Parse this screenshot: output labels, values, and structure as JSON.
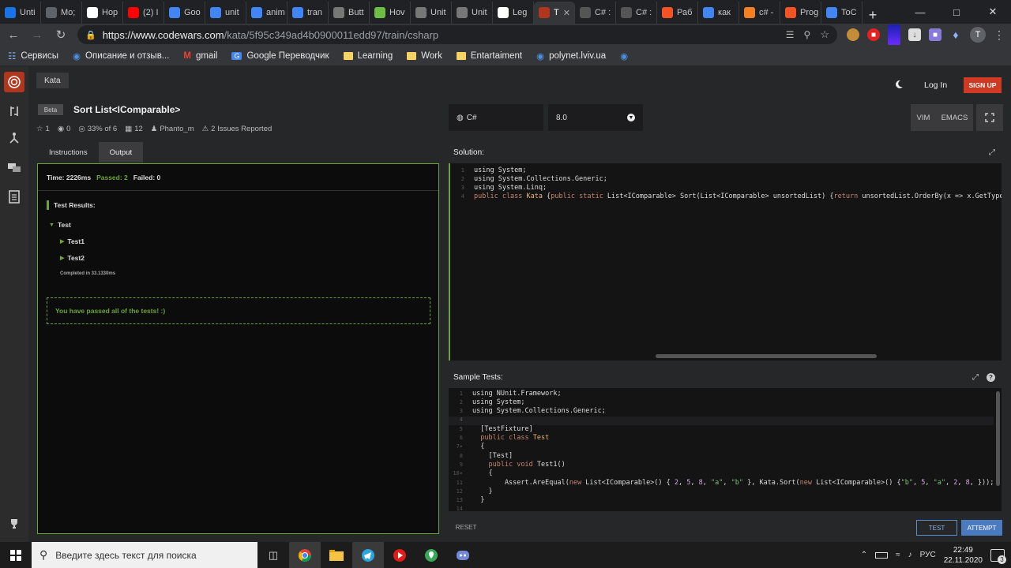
{
  "browser": {
    "tabs": [
      {
        "label": "Unti",
        "color": "#1a73e8"
      },
      {
        "label": "Mo;",
        "color": "#5f6368"
      },
      {
        "label": "Hop",
        "color": "#ffffff"
      },
      {
        "label": "(2) I",
        "color": "#ff0000"
      },
      {
        "label": "Goo",
        "color": "#4285f4"
      },
      {
        "label": "unit",
        "color": "#4285f4"
      },
      {
        "label": "anim",
        "color": "#4285f4"
      },
      {
        "label": "tran",
        "color": "#4285f4"
      },
      {
        "label": "Butt",
        "color": "#777777"
      },
      {
        "label": "Hov",
        "color": "#6cbe45"
      },
      {
        "label": "Unit",
        "color": "#777777"
      },
      {
        "label": "Unit",
        "color": "#777777"
      },
      {
        "label": "Leg",
        "color": "#ffffff"
      },
      {
        "label": "Т",
        "color": "#b1361e"
      },
      {
        "label": "C# :",
        "color": "#555555"
      },
      {
        "label": "C# :",
        "color": "#555555"
      },
      {
        "label": "Раб",
        "color": "#f35325"
      },
      {
        "label": "как",
        "color": "#4285f4"
      },
      {
        "label": "c# -",
        "color": "#f48024"
      },
      {
        "label": "Prog",
        "color": "#f35325"
      },
      {
        "label": "ToC",
        "color": "#4285f4"
      }
    ],
    "url_host": "https://www.codewars.com",
    "url_path": "/kata/5f95c349ad4b0900011edd97/train/csharp",
    "bookmarks": [
      {
        "label": "Сервисы",
        "type": "apps"
      },
      {
        "label": "Описание и отзыв...",
        "type": "site"
      },
      {
        "label": "gmail",
        "type": "gmail"
      },
      {
        "label": "Google Переводчик",
        "type": "translate"
      },
      {
        "label": "Learning",
        "type": "folder"
      },
      {
        "label": "Work",
        "type": "folder"
      },
      {
        "label": "Entartaiment",
        "type": "folder"
      },
      {
        "label": "polynet.lviv.ua",
        "type": "site"
      }
    ]
  },
  "codewars": {
    "kata_tab": "Kata",
    "login": "Log In",
    "signup": "SIGN UP",
    "beta": "Beta",
    "title": "Sort List<IComparable>",
    "stats": {
      "stars": "1",
      "favorites": "0",
      "satisfaction": "33% of 6",
      "completed": "12",
      "author": "Phanto_m",
      "issues": "2 Issues Reported"
    },
    "language": "C#",
    "version": "8.0",
    "mode_vim": "VIM",
    "mode_emacs": "EMACS",
    "tabs": {
      "instructions": "Instructions",
      "output": "Output"
    },
    "output": {
      "time": "Time: 2226ms",
      "passed": "Passed: 2",
      "failed": "Failed: 0",
      "results_title": "Test Results:",
      "group": "Test",
      "tests": [
        "Test1",
        "Test2"
      ],
      "completed": "Completed in 33.1330ms",
      "message": "You have passed all of the tests! :)"
    },
    "solution_title": "Solution:",
    "sample_title": "Sample Tests:",
    "reset": "RESET",
    "test": "TEST",
    "attempt": "ATTEMPT"
  },
  "taskbar": {
    "search_placeholder": "Введите здесь текст для поиска",
    "lang": "РУС",
    "time": "22:49",
    "date": "22.11.2020",
    "notifications": "3"
  }
}
